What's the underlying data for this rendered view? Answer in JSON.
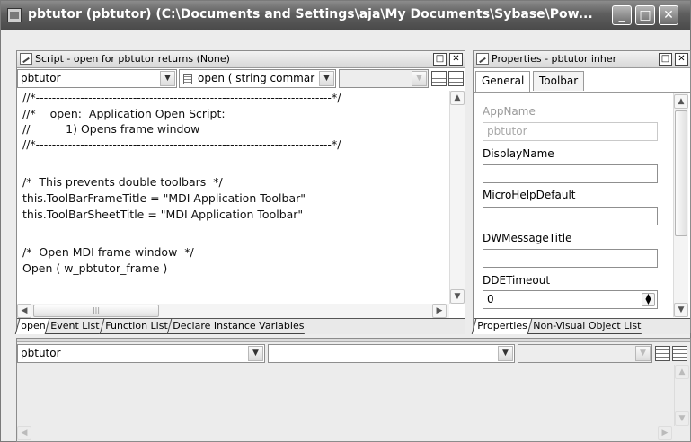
{
  "window": {
    "title": "pbtutor (pbtutor) (C:\\Documents and Settings\\aja\\My Documents\\Sybase\\Pow...",
    "buttons": {
      "minimize": "_",
      "maximize": "□",
      "close": "✕"
    }
  },
  "script_panel": {
    "title": "Script - open for pbtutor returns (None)",
    "object_dropdown": "pbtutor",
    "event_dropdown": "open ( string commar",
    "third_dropdown": "",
    "code_lines": [
      "//*-------------------------------------------------------------------------*/",
      "//*    open:  Application Open Script:",
      "//          1) Opens frame window",
      "//*-------------------------------------------------------------------------*/",
      "",
      "/*  This prevents double toolbars  */",
      "this.ToolBarFrameTitle = \"MDI Application Toolbar\"",
      "this.ToolBarSheetTitle = \"MDI Application Toolbar\"",
      "",
      "/*  Open MDI frame window  */",
      "Open ( w_pbtutor_frame )"
    ],
    "tabs": [
      "open",
      "Event List",
      "Function List",
      "Declare Instance Variables"
    ],
    "active_tab": 0
  },
  "properties_panel": {
    "title": "Properties - pbtutor  inher",
    "tabs": [
      "General",
      "Toolbar"
    ],
    "fields": [
      {
        "label": "AppName",
        "value": "pbtutor",
        "disabled": true
      },
      {
        "label": "DisplayName",
        "value": "",
        "disabled": false
      },
      {
        "label": "MicroHelpDefault",
        "value": "",
        "disabled": false
      },
      {
        "label": "DWMessageTitle",
        "value": "",
        "disabled": false
      },
      {
        "label": "DDETimeout",
        "value": "0",
        "disabled": false
      }
    ],
    "bottom_tabs": [
      "Properties",
      "Non-Visual Object List"
    ]
  },
  "lower_panel": {
    "object_dropdown": "pbtutor",
    "second_dropdown": "",
    "third_dropdown": ""
  }
}
